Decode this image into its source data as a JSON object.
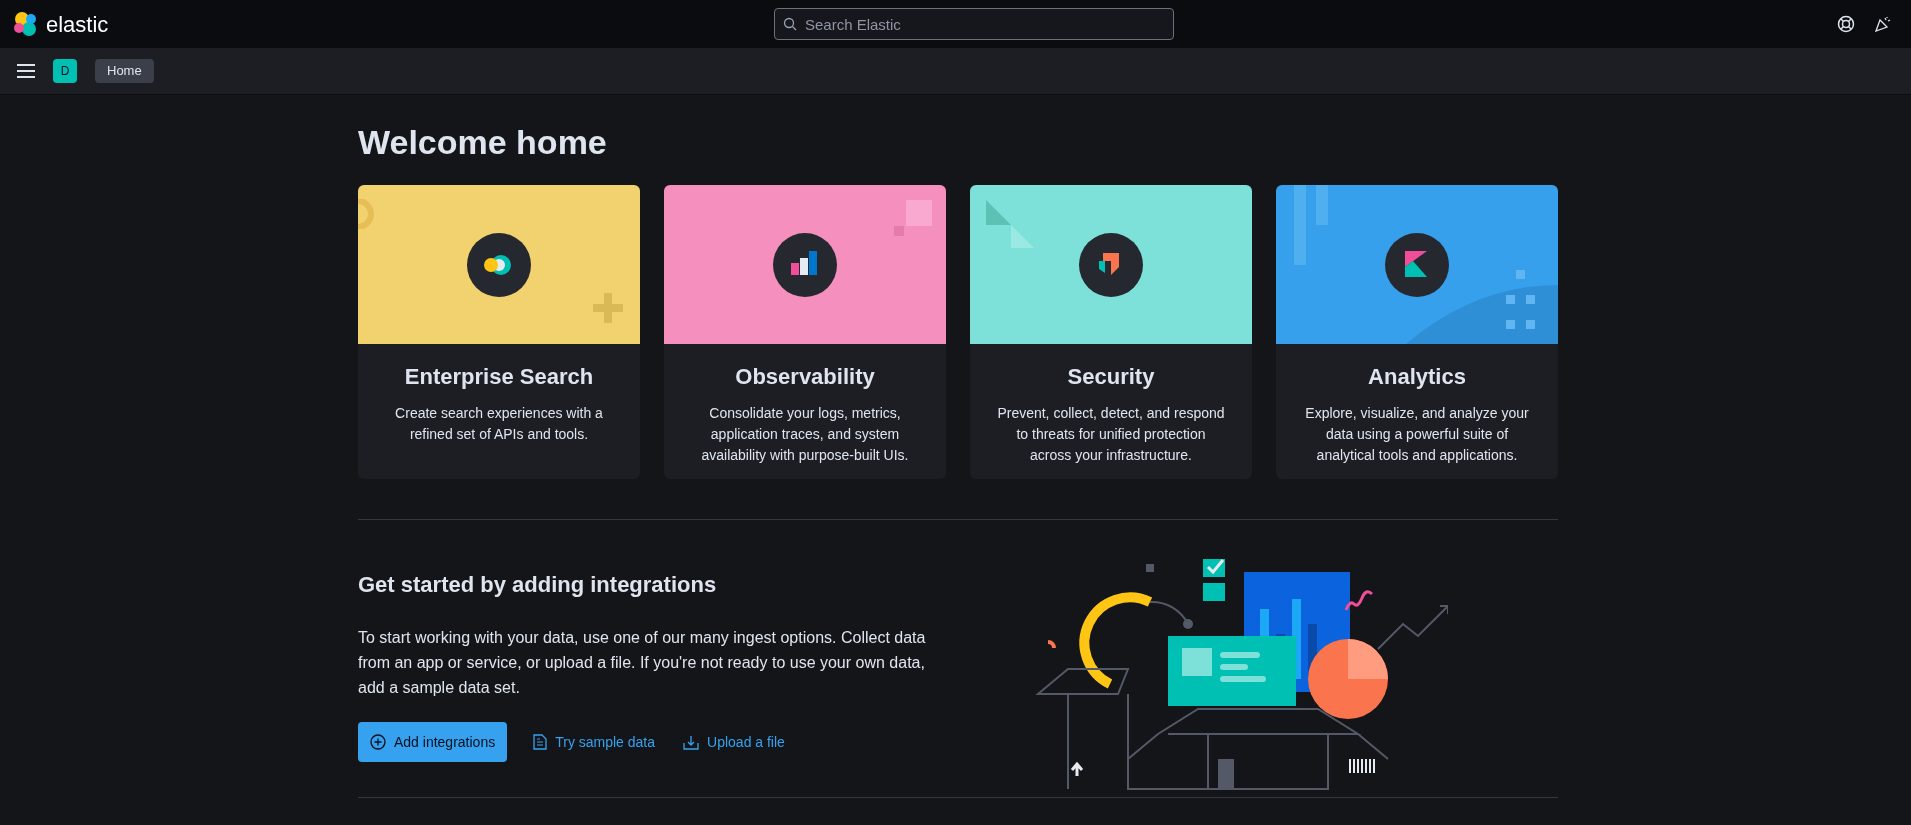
{
  "header": {
    "brand": "elastic",
    "search": {
      "placeholder": "Search Elastic"
    }
  },
  "breadcrumb_bar": {
    "space_badge": "D",
    "breadcrumbs": [
      "Home"
    ]
  },
  "title": "Welcome home",
  "solutions": [
    {
      "kind": "enterprise_search",
      "color": "#f1d26f",
      "title": "Enterprise Search",
      "description": "Create search experiences with a refined set of APIs and tools."
    },
    {
      "kind": "observability",
      "color": "#f58fbe",
      "title": "Observability",
      "description": "Consolidate your logs, metrics, application traces, and system availability with purpose-built UIs."
    },
    {
      "kind": "security",
      "color": "#7de0d9",
      "title": "Security",
      "description": "Prevent, collect, detect, and respond to threats for unified protection across your infrastructure."
    },
    {
      "kind": "analytics",
      "color": "#36a0ec",
      "title": "Analytics",
      "description": "Explore, visualize, and analyze your data using a powerful suite of analytical tools and applications."
    }
  ],
  "integrations": {
    "title": "Get started by adding integrations",
    "description": "To start working with your data, use one of our many ingest options. Collect data from an app or service, or upload a file. If you're not ready to use your own data, add a sample data set.",
    "actions": [
      {
        "kind": "primary",
        "label": "Add integrations"
      },
      {
        "kind": "sample",
        "label": "Try sample data"
      },
      {
        "kind": "upload",
        "label": "Upload a file"
      }
    ]
  }
}
